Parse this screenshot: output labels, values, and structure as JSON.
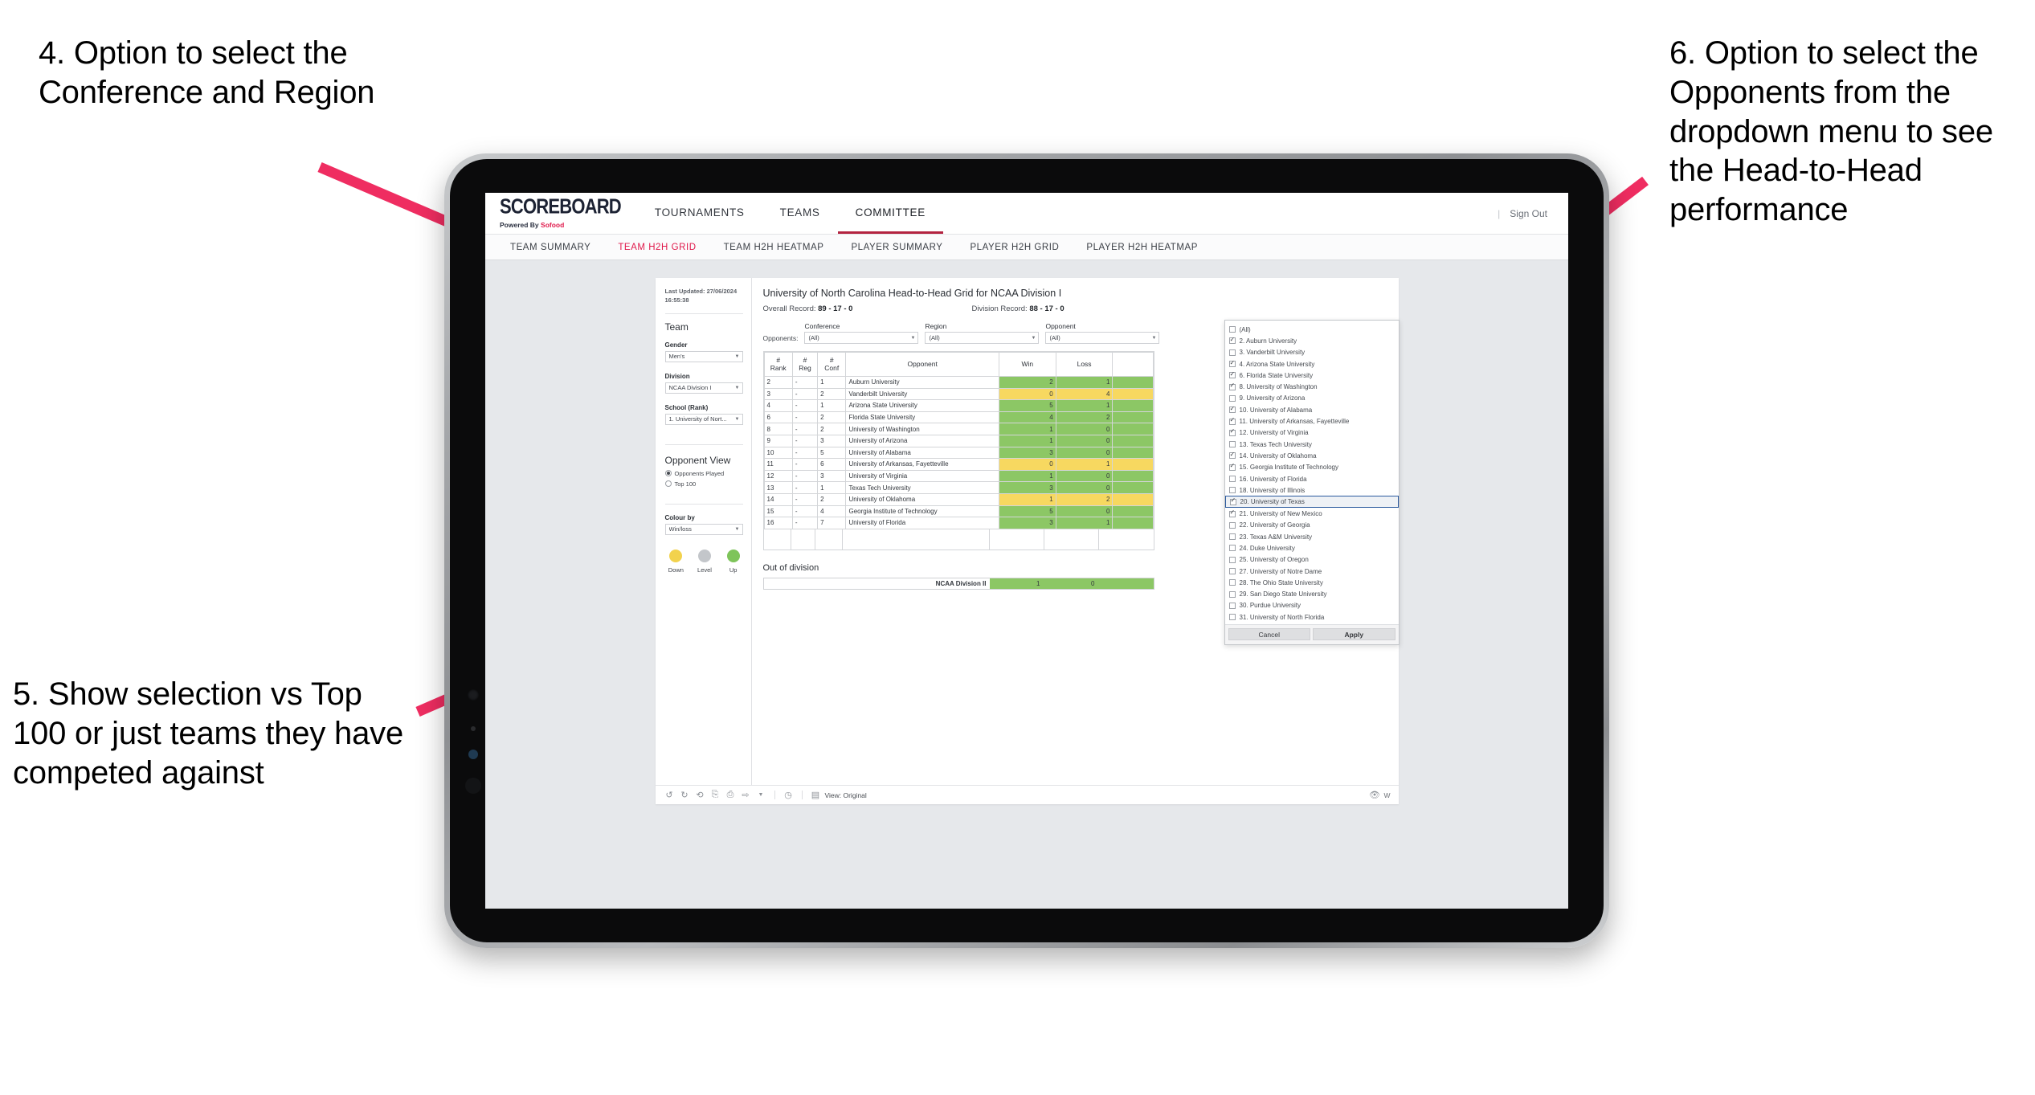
{
  "annotations": [
    {
      "id": "callout-4",
      "text": "4. Option to select the Conference and Region"
    },
    {
      "id": "callout-5",
      "text": "5. Show selection vs Top 100 or just teams they have competed against"
    },
    {
      "id": "callout-6",
      "text": "6. Option to select the Opponents from the dropdown menu to see the Head-to-Head performance"
    }
  ],
  "colors": {
    "arrow": "#ef2d61",
    "accent": "#e0194b",
    "active_tab_underline": "#b32340",
    "up_green": "#8cc765",
    "down_yellow": "#f7d860",
    "level_grey": "#c3c6ca",
    "selected_row_border": "#2c5a9e"
  },
  "site": {
    "brand_name": "SCOREBOARD",
    "brand_sub_prefix": "Powered By ",
    "brand_sub_accent": "Sofood",
    "top_nav": [
      {
        "label": "TOURNAMENTS",
        "active": false
      },
      {
        "label": "TEAMS",
        "active": false
      },
      {
        "label": "COMMITTEE",
        "active": true
      }
    ],
    "top_right": {
      "separator": "|",
      "sign_out": "Sign Out"
    },
    "sub_nav": [
      {
        "label": "TEAM SUMMARY",
        "active": false
      },
      {
        "label": "TEAM H2H GRID",
        "active": true
      },
      {
        "label": "TEAM H2H HEATMAP",
        "active": false
      },
      {
        "label": "PLAYER SUMMARY",
        "active": false
      },
      {
        "label": "PLAYER H2H GRID",
        "active": false
      },
      {
        "label": "PLAYER H2H HEATMAP",
        "active": false
      }
    ]
  },
  "filters": {
    "last_updated": "Last Updated: 27/06/2024 16:55:38",
    "team_heading": "Team",
    "gender": {
      "label": "Gender",
      "value": "Men's"
    },
    "division": {
      "label": "Division",
      "value": "NCAA Division I"
    },
    "school": {
      "label": "School (Rank)",
      "value": "1. University of Nort..."
    },
    "opponent_view": {
      "heading": "Opponent View",
      "options": [
        {
          "label": "Opponents Played",
          "selected": true
        },
        {
          "label": "Top 100",
          "selected": false
        }
      ]
    },
    "colour_by": {
      "label": "Colour by",
      "value": "Win/loss"
    },
    "legend": [
      {
        "label": "Down",
        "color": "#f2d24d"
      },
      {
        "label": "Level",
        "color": "#c3c6ca"
      },
      {
        "label": "Up",
        "color": "#7ec45a"
      }
    ]
  },
  "viz": {
    "title": "University of North Carolina Head-to-Head Grid for NCAA Division I",
    "overall_record_label": "Overall Record:",
    "overall_record_value": "89 - 17 - 0",
    "division_record_label": "Division Record:",
    "division_record_value": "88 - 17 - 0",
    "opponents_label": "Opponents:",
    "selectors": [
      {
        "caption": "Conference",
        "value": "(All)"
      },
      {
        "caption": "Region",
        "value": "(All)"
      },
      {
        "caption": "Opponent",
        "value": "(All)"
      }
    ],
    "out_of_division_title": "Out of division",
    "out_of_division_row": {
      "name": "NCAA Division II",
      "win": "1",
      "loss": "0",
      "state": "up"
    }
  },
  "chart_data": {
    "type": "table",
    "title": "University of North Carolina Head-to-Head Grid for NCAA Division I",
    "columns": [
      "# Rank",
      "# Reg",
      "# Conf",
      "Opponent",
      "Win",
      "Loss"
    ],
    "column_header_lines": [
      [
        "#",
        "Rank"
      ],
      [
        "#",
        "Reg"
      ],
      [
        "#",
        "Conf"
      ],
      [
        "Opponent"
      ],
      [
        "Win"
      ],
      [
        "Loss"
      ]
    ],
    "rows": [
      {
        "rank": "2",
        "reg": "-",
        "conf": "1",
        "opponent": "Auburn University",
        "win": "2",
        "loss": "1",
        "state": "up"
      },
      {
        "rank": "3",
        "reg": "-",
        "conf": "2",
        "opponent": "Vanderbilt University",
        "win": "0",
        "loss": "4",
        "state": "down"
      },
      {
        "rank": "4",
        "reg": "-",
        "conf": "1",
        "opponent": "Arizona State University",
        "win": "5",
        "loss": "1",
        "state": "up"
      },
      {
        "rank": "6",
        "reg": "-",
        "conf": "2",
        "opponent": "Florida State University",
        "win": "4",
        "loss": "2",
        "state": "up"
      },
      {
        "rank": "8",
        "reg": "-",
        "conf": "2",
        "opponent": "University of Washington",
        "win": "1",
        "loss": "0",
        "state": "up"
      },
      {
        "rank": "9",
        "reg": "-",
        "conf": "3",
        "opponent": "University of Arizona",
        "win": "1",
        "loss": "0",
        "state": "up"
      },
      {
        "rank": "10",
        "reg": "-",
        "conf": "5",
        "opponent": "University of Alabama",
        "win": "3",
        "loss": "0",
        "state": "up"
      },
      {
        "rank": "11",
        "reg": "-",
        "conf": "6",
        "opponent": "University of Arkansas, Fayetteville",
        "win": "0",
        "loss": "1",
        "state": "down"
      },
      {
        "rank": "12",
        "reg": "-",
        "conf": "3",
        "opponent": "University of Virginia",
        "win": "1",
        "loss": "0",
        "state": "up"
      },
      {
        "rank": "13",
        "reg": "-",
        "conf": "1",
        "opponent": "Texas Tech University",
        "win": "3",
        "loss": "0",
        "state": "up"
      },
      {
        "rank": "14",
        "reg": "-",
        "conf": "2",
        "opponent": "University of Oklahoma",
        "win": "1",
        "loss": "2",
        "state": "down"
      },
      {
        "rank": "15",
        "reg": "-",
        "conf": "4",
        "opponent": "Georgia Institute of Technology",
        "win": "5",
        "loss": "0",
        "state": "up"
      },
      {
        "rank": "16",
        "reg": "-",
        "conf": "7",
        "opponent": "University of Florida",
        "win": "3",
        "loss": "1",
        "state": "up"
      }
    ]
  },
  "opponent_dropdown": {
    "items": [
      {
        "label": "(All)",
        "checked": false,
        "highlighted": false
      },
      {
        "label": "2. Auburn University",
        "checked": true,
        "highlighted": false
      },
      {
        "label": "3. Vanderbilt University",
        "checked": false,
        "highlighted": false
      },
      {
        "label": "4. Arizona State University",
        "checked": true,
        "highlighted": false
      },
      {
        "label": "6. Florida State University",
        "checked": true,
        "highlighted": false
      },
      {
        "label": "8. University of Washington",
        "checked": true,
        "highlighted": false
      },
      {
        "label": "9. University of Arizona",
        "checked": false,
        "highlighted": false
      },
      {
        "label": "10. University of Alabama",
        "checked": true,
        "highlighted": false
      },
      {
        "label": "11. University of Arkansas, Fayetteville",
        "checked": true,
        "highlighted": false
      },
      {
        "label": "12. University of Virginia",
        "checked": true,
        "highlighted": false
      },
      {
        "label": "13. Texas Tech University",
        "checked": false,
        "highlighted": false
      },
      {
        "label": "14. University of Oklahoma",
        "checked": true,
        "highlighted": false
      },
      {
        "label": "15. Georgia Institute of Technology",
        "checked": true,
        "highlighted": false
      },
      {
        "label": "16. University of Florida",
        "checked": false,
        "highlighted": false
      },
      {
        "label": "18. University of Illinois",
        "checked": false,
        "highlighted": false
      },
      {
        "label": "20. University of Texas",
        "checked": true,
        "highlighted": true
      },
      {
        "label": "21. University of New Mexico",
        "checked": true,
        "highlighted": false
      },
      {
        "label": "22. University of Georgia",
        "checked": false,
        "highlighted": false
      },
      {
        "label": "23. Texas A&M University",
        "checked": false,
        "highlighted": false
      },
      {
        "label": "24. Duke University",
        "checked": false,
        "highlighted": false
      },
      {
        "label": "25. University of Oregon",
        "checked": false,
        "highlighted": false
      },
      {
        "label": "27. University of Notre Dame",
        "checked": false,
        "highlighted": false
      },
      {
        "label": "28. The Ohio State University",
        "checked": false,
        "highlighted": false
      },
      {
        "label": "29. San Diego State University",
        "checked": false,
        "highlighted": false
      },
      {
        "label": "30. Purdue University",
        "checked": false,
        "highlighted": false
      },
      {
        "label": "31. University of North Florida",
        "checked": false,
        "highlighted": false
      }
    ],
    "cancel_label": "Cancel",
    "apply_label": "Apply"
  },
  "toolbar": {
    "view_label": "View: Original",
    "right_label": "W"
  }
}
